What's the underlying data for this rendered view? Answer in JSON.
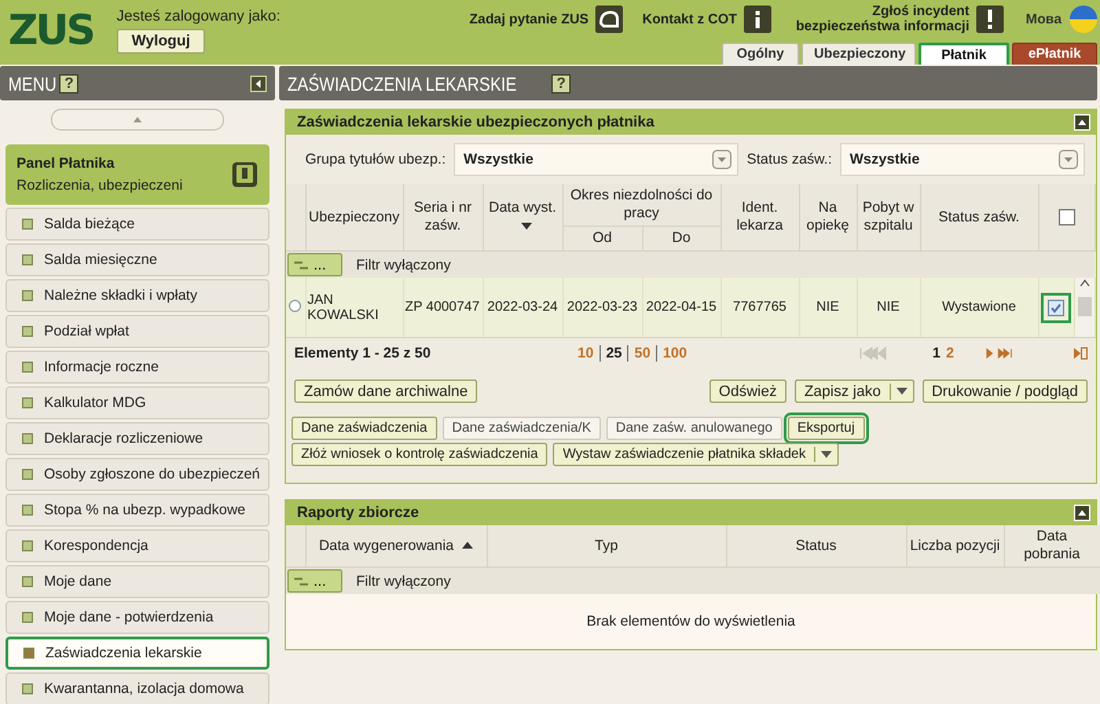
{
  "header": {
    "logo": "ZUS",
    "logged_in_label": "Jesteś zalogowany jako:",
    "logout": "Wyloguj",
    "links": [
      {
        "label": "Zadaj pytanie ZUS",
        "kind": "chat"
      },
      {
        "label": "Kontakt z COT",
        "kind": "info"
      },
      {
        "label": "Zgłoś incydent bezpieczeństwa informacji",
        "kind": "alert"
      }
    ],
    "language": "Мова"
  },
  "tabs": [
    {
      "label": "Ogólny",
      "selected": false,
      "kind": "normal"
    },
    {
      "label": "Ubezpieczony",
      "selected": false,
      "kind": "normal"
    },
    {
      "label": "Płatnik",
      "selected": true,
      "kind": "normal"
    },
    {
      "label": "ePłatnik",
      "selected": false,
      "kind": "special"
    }
  ],
  "sidebar": {
    "title": "MENU",
    "help": "?",
    "panel": {
      "title": "Panel Płatnika",
      "subtitle": "Rozliczenia, ubezpieczeni"
    },
    "items": [
      {
        "label": "Salda bieżące",
        "selected": false
      },
      {
        "label": "Salda miesięczne",
        "selected": false
      },
      {
        "label": "Należne składki i wpłaty",
        "selected": false
      },
      {
        "label": "Podział wpłat",
        "selected": false
      },
      {
        "label": "Informacje roczne",
        "selected": false
      },
      {
        "label": "Kalkulator MDG",
        "selected": false
      },
      {
        "label": "Deklaracje rozliczeniowe",
        "selected": false
      },
      {
        "label": "Osoby zgłoszone do ubezpieczeń",
        "selected": false
      },
      {
        "label": "Stopa % na ubezp. wypadkowe",
        "selected": false
      },
      {
        "label": "Korespondencja",
        "selected": false
      },
      {
        "label": "Moje dane",
        "selected": false
      },
      {
        "label": "Moje dane - potwierdzenia",
        "selected": false
      },
      {
        "label": "Zaświadczenia lekarskie",
        "selected": true
      },
      {
        "label": "Kwarantanna, izolacja domowa",
        "selected": false
      }
    ]
  },
  "main": {
    "title": "ZAŚWIADCZENIA LEKARSKIE",
    "help": "?",
    "certificates": {
      "title": "Zaświadczenia lekarskie ubezpieczonych płatnika",
      "filters": [
        {
          "label": "Grupa tytułów ubezp.:",
          "value": "Wszystkie"
        },
        {
          "label": "Status zaśw.:",
          "value": "Wszystkie"
        }
      ],
      "columns": [
        {
          "label": "Ubezpieczony",
          "sorted": false
        },
        {
          "label": "Seria i nr zaśw.",
          "sorted": false
        },
        {
          "label": "Data wyst.",
          "sorted": true,
          "ascending": false
        },
        {
          "label": "Okres niezdolności do pracy",
          "colspan": 2,
          "subcolumns": [
            "Od",
            "Do"
          ]
        },
        {
          "label": "Ident. lekarza",
          "sorted": false
        },
        {
          "label": "Na opiekę",
          "sorted": false
        },
        {
          "label": "Pobyt w szpitalu",
          "sorted": false
        },
        {
          "label": "Status zaśw.",
          "sorted": false
        }
      ],
      "header_checked": false,
      "filter_button": "...",
      "filter_status": "Filtr wyłączony",
      "rows": [
        {
          "selected": false,
          "checked": true,
          "highlighted": true,
          "cells": [
            "JAN KOWALSKI",
            "ZP 4000747",
            "2022-03-24",
            "2022-03-23",
            "2022-04-15",
            "7767765",
            "NIE",
            "NIE",
            "Wystawione"
          ]
        }
      ],
      "summary": "Elementy 1 - 25 z 50",
      "page_sizes": [
        {
          "label": "10",
          "selected": false
        },
        {
          "label": "25",
          "selected": true
        },
        {
          "label": "50",
          "selected": false
        },
        {
          "label": "100",
          "selected": false
        }
      ],
      "pages": [
        {
          "label": "1",
          "selected": true
        },
        {
          "label": "2",
          "selected": false
        }
      ],
      "toolbar_left": [
        {
          "label": "Zamów dane archiwalne",
          "dropdown": false
        }
      ],
      "toolbar_right": [
        {
          "label": "Odśwież",
          "dropdown": false
        },
        {
          "label": "Zapisz jako",
          "dropdown": true
        },
        {
          "label": "Drukowanie / podgląd",
          "dropdown": false
        }
      ],
      "actions": [
        {
          "label": "Dane zaświadczenia",
          "disabled": false,
          "highlighted": false,
          "dropdown": false
        },
        {
          "label": "Dane zaświadczenia/K",
          "disabled": true,
          "highlighted": false,
          "dropdown": false
        },
        {
          "label": "Dane zaśw. anulowanego",
          "disabled": true,
          "highlighted": false,
          "dropdown": false
        },
        {
          "label": "Eksportuj",
          "disabled": false,
          "highlighted": true,
          "dropdown": false
        },
        {
          "label": "Złóż wniosek o kontrolę zaświadczenia",
          "disabled": false,
          "highlighted": false,
          "dropdown": false
        },
        {
          "label": "Wystaw zaświadczenie płatnika składek",
          "disabled": false,
          "highlighted": false,
          "dropdown": true
        }
      ]
    },
    "reports": {
      "title": "Raporty zbiorcze",
      "columns": [
        {
          "label": "Data wygenerowania",
          "sorted": true,
          "ascending": true
        },
        {
          "label": "Typ",
          "sorted": false
        },
        {
          "label": "Status",
          "sorted": false
        },
        {
          "label": "Liczba pozycji",
          "sorted": false
        },
        {
          "label": "Data pobrania",
          "sorted": false
        }
      ],
      "filter_button": "...",
      "filter_status": "Filtr wyłączony",
      "empty": "Brak elementów do wyświetlenia"
    }
  }
}
